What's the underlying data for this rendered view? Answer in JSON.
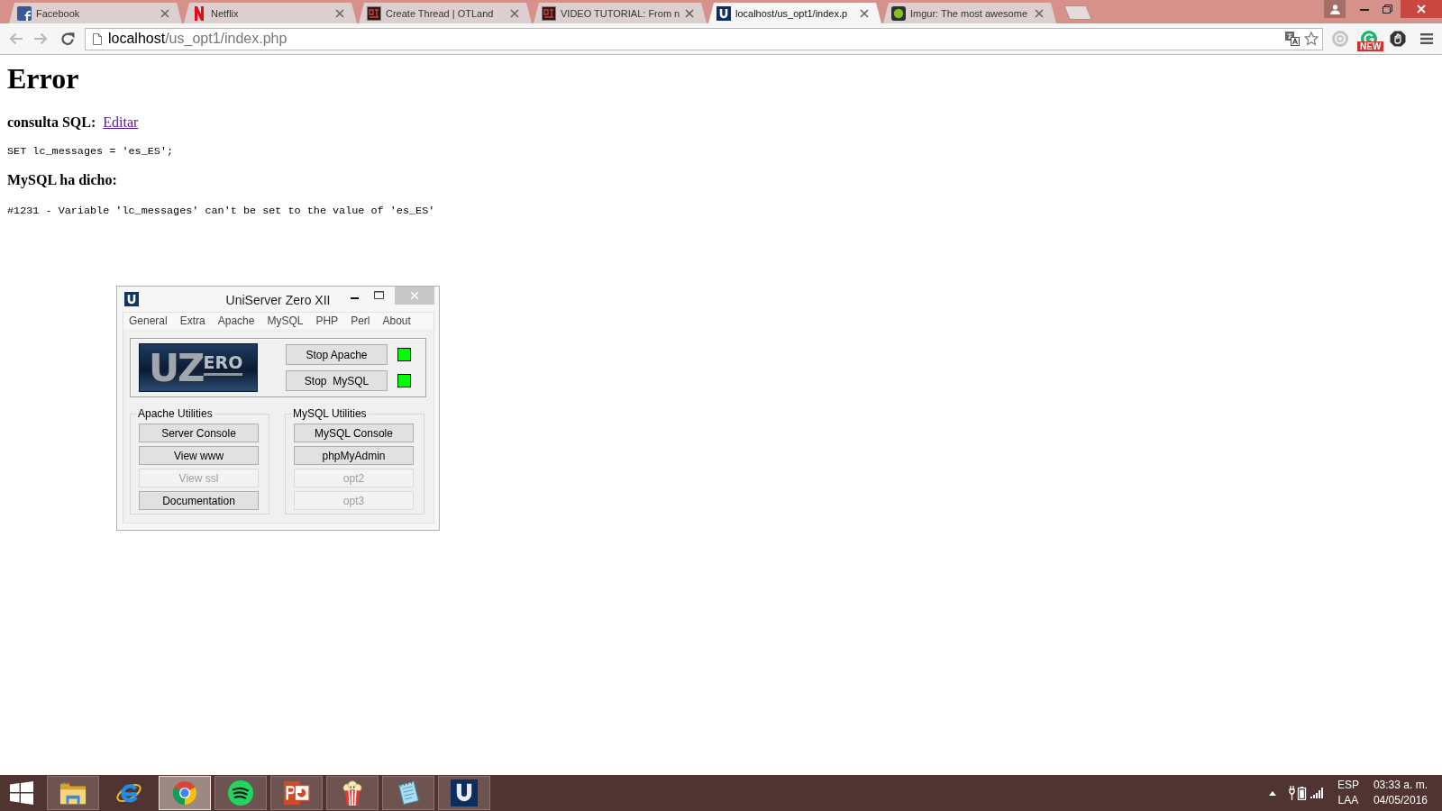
{
  "browser": {
    "tabs": [
      {
        "title": "Facebook",
        "kind": "facebook",
        "selected": false
      },
      {
        "title": "Netflix",
        "kind": "netflix",
        "selected": false
      },
      {
        "title": "Create Thread | OTLand",
        "kind": "otland",
        "selected": false
      },
      {
        "title": "VIDEO TUTORIAL: From n",
        "kind": "otland",
        "selected": false
      },
      {
        "title": "localhost/us_opt1/index.p",
        "kind": "uniserver",
        "selected": true
      },
      {
        "title": "Imgur: The most awesome",
        "kind": "imgur",
        "selected": false
      }
    ],
    "address": {
      "host": "localhost",
      "path": "/us_opt1/index.php"
    },
    "extension_badge": "NEW"
  },
  "page": {
    "heading": "Error",
    "query_label": "consulta SQL:",
    "edit_link": "Editar",
    "query": "SET lc_messages = 'es_ES';",
    "response_label": "MySQL ha dicho:",
    "error": "#1231 - Variable 'lc_messages' can't be set to the value of 'es_ES'"
  },
  "uniserver": {
    "title": "UniServer Zero XII",
    "menu": [
      "General",
      "Extra",
      "Apache",
      "MySQL",
      "PHP",
      "Perl",
      "About"
    ],
    "logo": [
      "U",
      "Z",
      "ERO"
    ],
    "services": [
      {
        "label": "Stop Apache",
        "running": true
      },
      {
        "label": "Stop  MySQL",
        "running": true
      }
    ],
    "groups": [
      {
        "title": "Apache Utilities",
        "buttons": [
          {
            "label": "Server Console",
            "disabled": false
          },
          {
            "label": "View www",
            "disabled": false
          },
          {
            "label": "View ssl",
            "disabled": true
          },
          {
            "label": "Documentation",
            "disabled": false
          }
        ]
      },
      {
        "title": "MySQL Utilities",
        "buttons": [
          {
            "label": "MySQL Console",
            "disabled": false
          },
          {
            "label": "phpMyAdmin",
            "disabled": false
          },
          {
            "label": "opt2",
            "disabled": true
          },
          {
            "label": "opt3",
            "disabled": true
          }
        ]
      }
    ]
  },
  "taskbar": {
    "apps": [
      {
        "kind": "explorer",
        "running": true,
        "selected": false
      },
      {
        "kind": "ie",
        "running": false,
        "selected": false
      },
      {
        "kind": "chrome",
        "running": true,
        "selected": true
      },
      {
        "kind": "spotify",
        "running": true,
        "selected": false
      },
      {
        "kind": "powerpoint",
        "running": true,
        "selected": false
      },
      {
        "kind": "popcorn",
        "running": true,
        "selected": false
      },
      {
        "kind": "notepad",
        "running": true,
        "selected": false
      },
      {
        "kind": "uniserver",
        "running": true,
        "selected": false
      }
    ],
    "tray": {
      "language": "ESP",
      "layout": "LAA",
      "time": "03:33 a. m.",
      "date": "04/05/2016"
    }
  }
}
